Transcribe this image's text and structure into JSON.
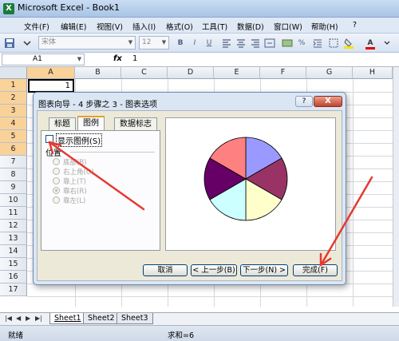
{
  "window": {
    "title": "Microsoft Excel - Book1",
    "app_icon": "X"
  },
  "menu": {
    "items": [
      "文件(F)",
      "编辑(E)",
      "视图(V)",
      "插入(I)",
      "格式(O)",
      "工具(T)",
      "数据(D)",
      "窗口(W)",
      "帮助(H)"
    ],
    "help_question": "?"
  },
  "toolbar": {
    "font_name": "宋体",
    "font_size": "12",
    "bold": "B",
    "italic": "I",
    "underline": "U",
    "fill_color": "#f5e400",
    "font_color": "#e00000",
    "font_color_letter": "A"
  },
  "formula_bar": {
    "name_box": "A1",
    "fx": "fx",
    "value": "1"
  },
  "grid": {
    "columns": [
      "A",
      "B",
      "C",
      "D",
      "E",
      "F",
      "G",
      "H"
    ],
    "rows": [
      "1",
      "2",
      "3",
      "4",
      "5",
      "6",
      "7",
      "8",
      "9",
      "10",
      "11",
      "12",
      "13",
      "14",
      "15",
      "16",
      "17"
    ],
    "selected_rows": [
      "1",
      "2",
      "3",
      "4",
      "5",
      "6"
    ],
    "cell_a1": "1"
  },
  "sheets": {
    "nav": [
      "|◀",
      "◀",
      "▶",
      "▶|"
    ],
    "tabs": [
      "Sheet1",
      "Sheet2",
      "Sheet3"
    ],
    "active": "Sheet1"
  },
  "status": {
    "ready": "就绪",
    "sum": "求和=6"
  },
  "dialog": {
    "title": "图表向导 - 4 步骤之 3 - 图表选项",
    "help": "?",
    "close": "X",
    "tabs": [
      "标题",
      "图例",
      "数据标志"
    ],
    "active_tab": "图例",
    "show_legend": "显示图例(S)",
    "show_legend_checked": false,
    "placement_title": "位置",
    "placements": [
      "底部(B)",
      "右上角(O)",
      "靠上(T)",
      "靠右(R)",
      "靠左(L)"
    ],
    "placement_selected": "靠右(R)",
    "buttons": {
      "cancel": "取消",
      "back": "< 上一步(B)",
      "next": "下一步(N) >",
      "finish": "完成(F)"
    }
  },
  "preview_pie": {
    "slices": [
      {
        "color": "#9999ff",
        "value": 1
      },
      {
        "color": "#993366",
        "value": 1
      },
      {
        "color": "#ffffcc",
        "value": 1
      },
      {
        "color": "#ccffff",
        "value": 1
      },
      {
        "color": "#660066",
        "value": 1
      },
      {
        "color": "#ff8080",
        "value": 1
      }
    ]
  },
  "annotation_color": "#e53a30"
}
